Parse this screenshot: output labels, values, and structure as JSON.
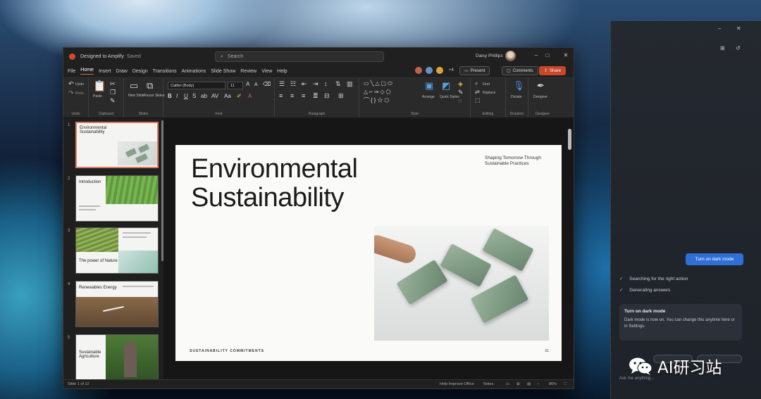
{
  "window": {
    "doc_title": "Designed to Amplify",
    "doc_status": "Saved",
    "search_placeholder": "Search",
    "user_name": "Daisy Phillips",
    "controls": {
      "minimize": "–",
      "maximize": "□",
      "close": "✕"
    }
  },
  "menu": {
    "tabs": [
      "File",
      "Home",
      "Insert",
      "Draw",
      "Design",
      "Transitions",
      "Animations",
      "Slide Show",
      "Review",
      "View",
      "Help"
    ],
    "active_tab": "Home",
    "collaborators_extra": "+4",
    "present_label": "Present",
    "comments_label": "Comments",
    "share_label": "Share"
  },
  "ribbon": {
    "undo_label": "Undo",
    "redo_label": "Redo",
    "paste_label": "Paste",
    "new_slide_label": "New Slide",
    "reuse_slides_label": "Reuse Slides",
    "font_name": "Calibri (Body)",
    "font_size": "11",
    "arrange_label": "Arrange",
    "quick_styles_label": "Quick Styles",
    "find_label": "Find",
    "replace_label": "Replace",
    "dictate_label": "Dictate",
    "designer_label": "Designer",
    "groups": {
      "undo": "Undo",
      "clipboard": "Clipboard",
      "slides": "Slides",
      "font": "Font",
      "paragraph": "Paragraph",
      "style": "Style",
      "editing": "Editing",
      "dictation": "Dictation",
      "designer": "Designer"
    }
  },
  "thumbnails": [
    {
      "num": "1",
      "title": "Environmental Sustainability"
    },
    {
      "num": "2",
      "title": "Introduction"
    },
    {
      "num": "3",
      "title": "The power of Nature"
    },
    {
      "num": "4",
      "title": "Renewables Energy"
    },
    {
      "num": "5",
      "title": "Sustainable Agriculture"
    }
  ],
  "slide": {
    "title_line1": "Environmental",
    "title_line2": "Sustainability",
    "subtitle": "Shaping Tomorrow Through Sustainable Practices",
    "footer": "SUSTAINABILITY COMMITMENTS",
    "page": "01"
  },
  "statusbar": {
    "slide_count": "Slide 1 of 12",
    "help_improve": "Help Improve Office",
    "notes": "Notes",
    "zoom": "86%"
  },
  "copilot": {
    "dark_mode_button": "Turn on dark mode",
    "status_searching": "Searching for the right action",
    "status_generating": "Generating answers",
    "card_title": "Turn on dark mode",
    "card_body": "Dark mode is now on. You can change this anytime here or in Settings.",
    "input_placeholder": "Ask me anything..."
  },
  "watermark": {
    "text": "AI研习站"
  },
  "colors": {
    "accent": "#c8462a",
    "copilot_button": "#2f6fd6",
    "active_tab_underline": "#e06844"
  }
}
